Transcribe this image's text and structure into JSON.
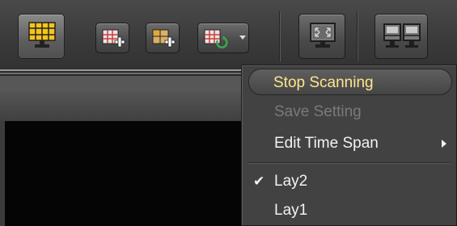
{
  "toolbar": {
    "buttons": [
      {
        "icon": "layout-grid-icon",
        "active": true,
        "color": "#f5c518"
      },
      {
        "icon": "add-layout-icon",
        "active": false
      },
      {
        "icon": "add-layout-alt-icon",
        "active": false
      },
      {
        "icon": "layout-scan-icon",
        "active": false,
        "has_dropdown": true
      },
      {
        "icon": "fullscreen-monitor-icon",
        "active": false
      },
      {
        "icon": "dual-monitor-icon",
        "active": false
      }
    ]
  },
  "menu": {
    "items": [
      {
        "label": "Stop Scanning",
        "highlighted": true,
        "enabled": true
      },
      {
        "label": "Save Setting",
        "highlighted": false,
        "enabled": false
      },
      {
        "label": "Edit Time Span",
        "highlighted": false,
        "enabled": true,
        "has_submenu": true
      },
      {
        "label": "Lay2",
        "checked": true,
        "enabled": true
      },
      {
        "label": "Lay1",
        "checked": false,
        "enabled": true
      }
    ]
  },
  "colors": {
    "highlight_text": "#ffe58a",
    "menu_text": "#f2f2f2",
    "disabled_text": "#7a7a7a",
    "accent_yellow": "#f5c518",
    "icon_red": "#d23a3a"
  }
}
